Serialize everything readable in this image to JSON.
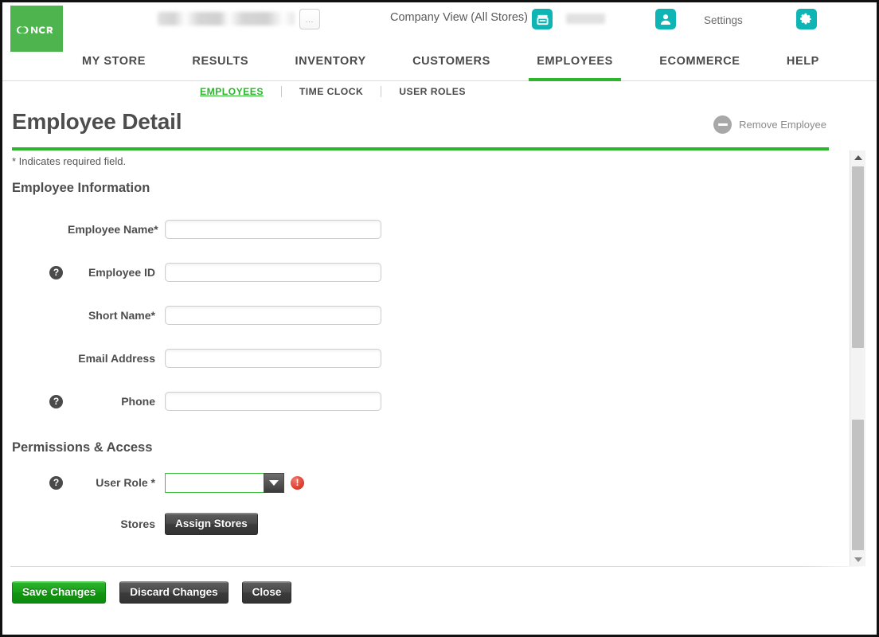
{
  "masthead": {
    "logo_alt": "NCR",
    "store_name_redacted": "",
    "ellipsis_button_label": "...",
    "company_view_label": "Company View (All Stores)",
    "store_badge_redacted": "",
    "settings_label": "Settings"
  },
  "primary_nav": {
    "items": [
      {
        "label": "MY STORE",
        "active": false
      },
      {
        "label": "RESULTS",
        "active": false
      },
      {
        "label": "INVENTORY",
        "active": false
      },
      {
        "label": "CUSTOMERS",
        "active": false
      },
      {
        "label": "EMPLOYEES",
        "active": true
      },
      {
        "label": "ECOMMERCE",
        "active": false
      },
      {
        "label": "HELP",
        "active": false
      }
    ]
  },
  "sub_nav": {
    "items": [
      {
        "label": "EMPLOYEES",
        "active": true
      },
      {
        "label": "TIME CLOCK",
        "active": false
      },
      {
        "label": "USER ROLES",
        "active": false
      }
    ]
  },
  "page": {
    "title": "Employee Detail",
    "remove_employee_label": "Remove Employee",
    "required_note": "* Indicates required field."
  },
  "sections": {
    "employee_information": "Employee Information",
    "permissions_access": "Permissions & Access"
  },
  "fields": {
    "employee_name": {
      "label": "Employee Name*",
      "value": "",
      "placeholder": "",
      "help": false
    },
    "employee_id": {
      "label": "Employee ID",
      "value": "",
      "placeholder": "",
      "help": true
    },
    "short_name": {
      "label": "Short Name*",
      "value": "",
      "placeholder": "",
      "help": false
    },
    "email_address": {
      "label": "Email Address",
      "value": "",
      "placeholder": "",
      "help": false
    },
    "phone": {
      "label": "Phone",
      "value": "",
      "placeholder": "",
      "help": true
    },
    "user_role": {
      "label": "User Role *",
      "value": "",
      "help": true,
      "error": true
    },
    "stores": {
      "label": "Stores"
    }
  },
  "buttons": {
    "assign_stores": "Assign Stores",
    "save_changes": "Save Changes",
    "discard_changes": "Discard Changes",
    "close": "Close"
  },
  "icons": {
    "help": "?",
    "error": "!"
  },
  "colors": {
    "brand_green": "#4eb44e",
    "accent_green": "#2db52d",
    "teal": "#0fb5b5",
    "error_red": "#de4433",
    "text_dark": "#4d4d4d"
  }
}
